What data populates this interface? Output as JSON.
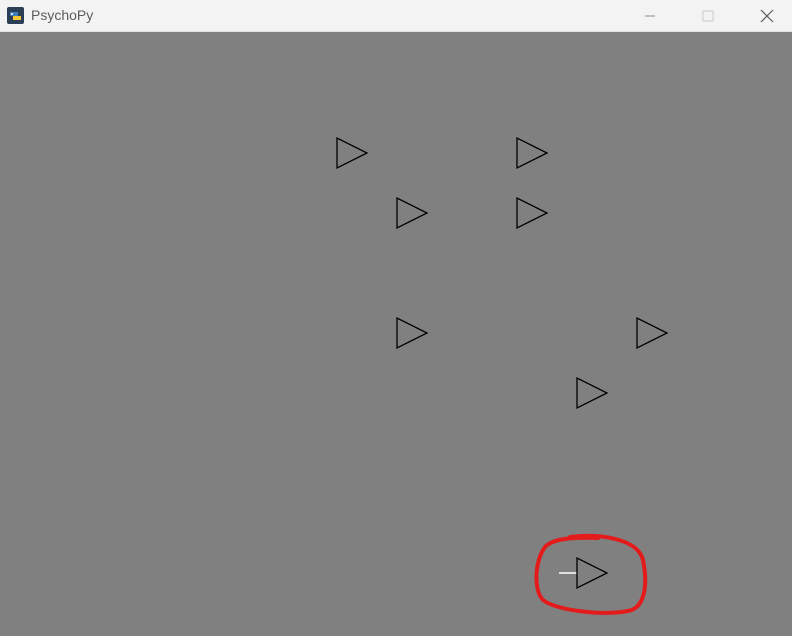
{
  "window": {
    "title": "PsychoPy",
    "app_icon": "psychopy-icon",
    "controls": [
      "minimize-icon",
      "maximize-icon",
      "close-icon"
    ]
  },
  "stimulus": {
    "background_color": "#808080",
    "shape": "right-pointing-triangle-outline",
    "stroke_color": "#000000",
    "count": 8,
    "target": {
      "shape": "right-pointing-triangle-outline",
      "indicator": "white-line-left-of-target",
      "annotation": "red-circle-highlight",
      "annotation_color": "#e31b1b"
    }
  }
}
